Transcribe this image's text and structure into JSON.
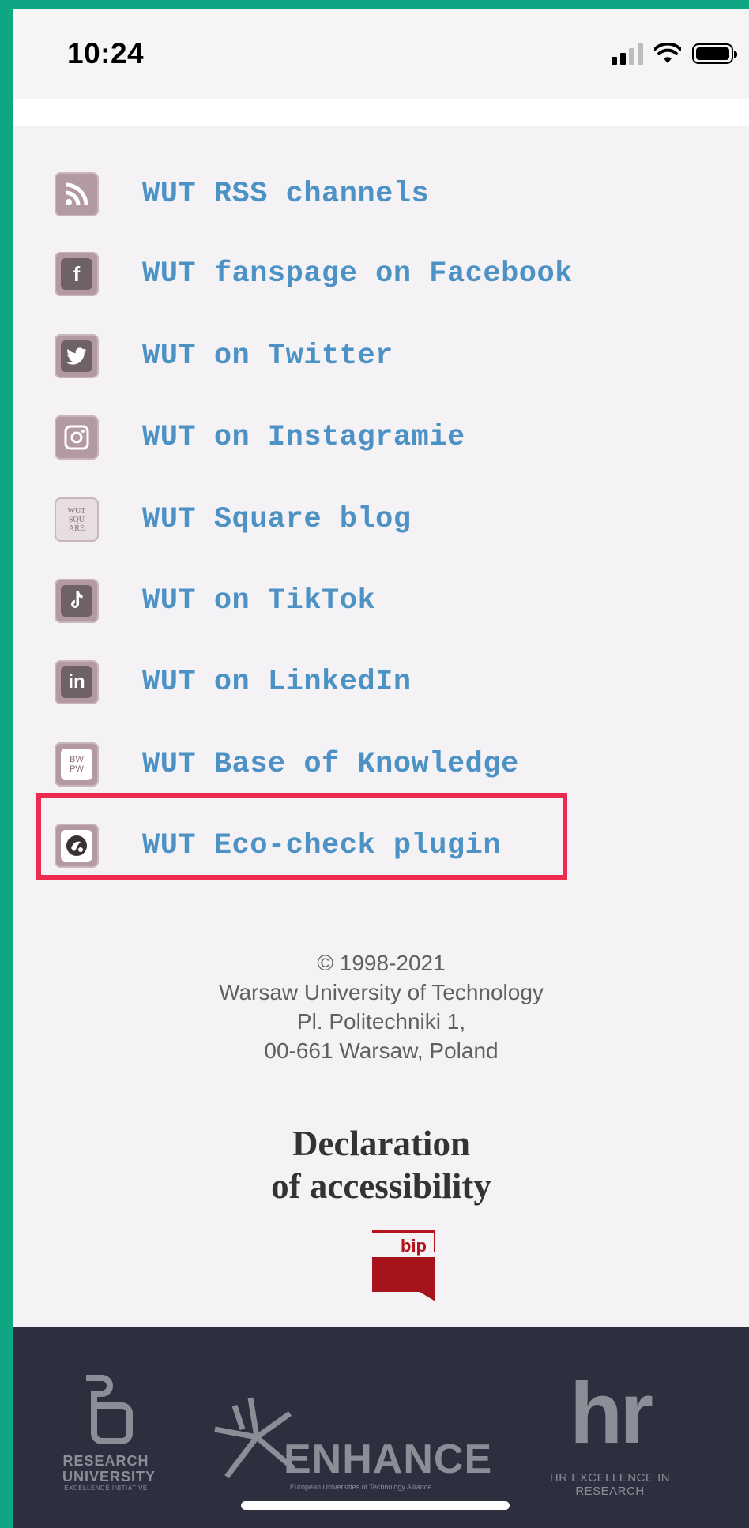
{
  "status_bar": {
    "time": "10:24"
  },
  "links": [
    {
      "label": "WUT RSS channels",
      "icon": "rss-icon"
    },
    {
      "label": "WUT fanspage on Facebook",
      "icon": "facebook-icon"
    },
    {
      "label": "WUT on Twitter",
      "icon": "twitter-icon"
    },
    {
      "label": "WUT on Instagramie",
      "icon": "instagram-icon"
    },
    {
      "label": "WUT Square blog",
      "icon": "wut-square-icon",
      "icon_text": "WUT SQU ARE"
    },
    {
      "label": "WUT on TikTok",
      "icon": "tiktok-icon"
    },
    {
      "label": "WUT on LinkedIn",
      "icon": "linkedin-icon",
      "icon_text": "in"
    },
    {
      "label": "WUT Base of Knowledge",
      "icon": "bwpw-icon",
      "icon_text": "BW PW"
    },
    {
      "label": "WUT Eco-check plugin",
      "icon": "eco-check-icon"
    }
  ],
  "footer": {
    "copyright": "© 1998-2021",
    "university": "Warsaw University of Technology",
    "street": "Pl. Politechniki 1,",
    "city": "00-661 Warsaw, Poland",
    "declaration_line1": "Declaration",
    "declaration_line2": "of accessibility",
    "bip_label": "bip"
  },
  "partners": {
    "research_university": "RESEARCH",
    "research_university_2": "UNIVERSITY",
    "research_university_sub": "EXCELLENCE INITIATIVE",
    "enhance": "ENHANCE",
    "enhance_sub": "European Universities of Technology Alliance",
    "hr": "hr",
    "hr_sub": "HR EXCELLENCE IN RESEARCH"
  },
  "colors": {
    "accent_link": "#4d92c4",
    "highlight": "#ee2a4e",
    "dark_band": "#2d2f3f"
  }
}
